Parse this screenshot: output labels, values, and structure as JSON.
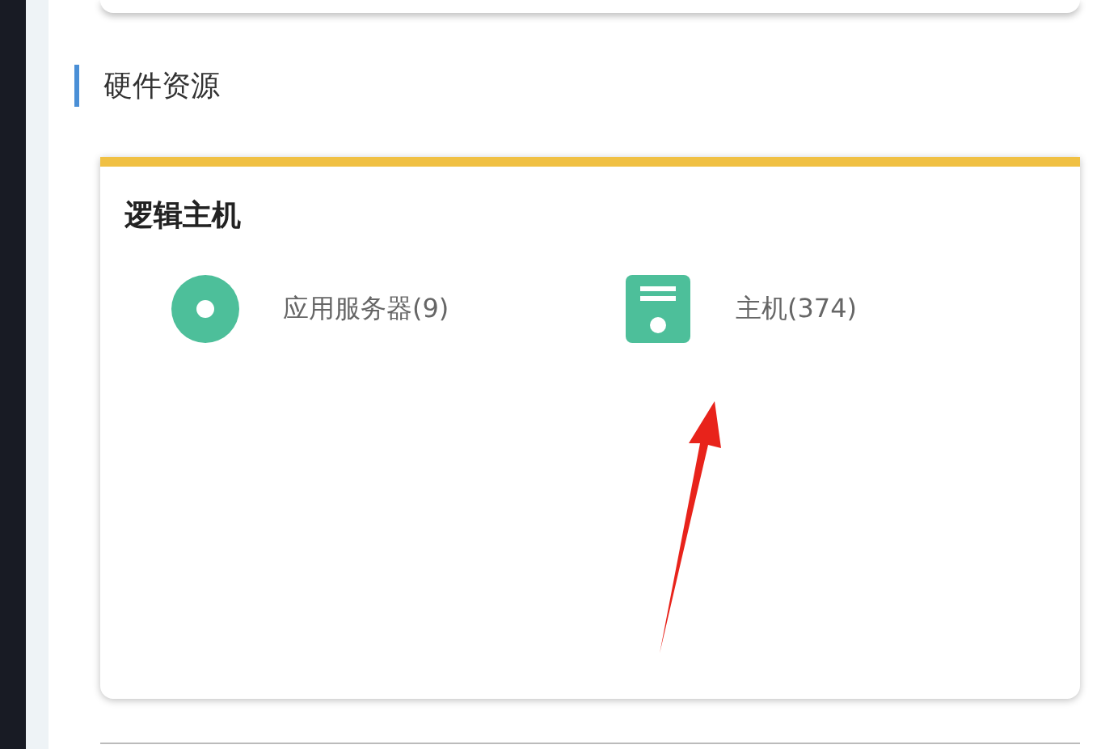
{
  "section": {
    "title": "硬件资源"
  },
  "card": {
    "title": "逻辑主机",
    "items": [
      {
        "kind": "disc",
        "label": "应用服务器(9)"
      },
      {
        "kind": "host",
        "label": "主机(374)"
      }
    ]
  }
}
